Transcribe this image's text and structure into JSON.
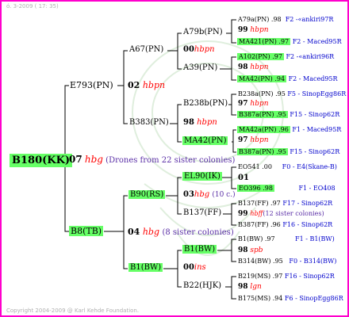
{
  "header": "ó. 3-2009 ( 17: 35)",
  "footer": "Copyright 2004-2009 @ Karl Kehde Foundation.",
  "root": {
    "name": "B180(KK)",
    "year": "07",
    "species": "hbg",
    "note": "(Drones from 22 sister colonies)"
  },
  "gen1": [
    {
      "name": "E793(PN)",
      "year": "02",
      "species": "hbpn"
    },
    {
      "name": "B8(TB)",
      "year": "04",
      "species": "hbg",
      "note": "(8 sister colonies)"
    }
  ],
  "gen2": [
    {
      "name": "A67(PN)",
      "year": "00",
      "species": "hbpn"
    },
    {
      "name": "B383(PN)",
      "year": "98",
      "species": "hbpn"
    },
    {
      "name": "B90(RS)",
      "year": "03",
      "species": "hbg",
      "note": "(10 c.)"
    },
    {
      "name": "B1(BW)",
      "year": "00",
      "species": "ins"
    }
  ],
  "gen3": [
    {
      "name": "A79b(PN)"
    },
    {
      "name": "A39(PN)"
    },
    {
      "name": "B238b(PN)"
    },
    {
      "name": "MA42(PN)"
    },
    {
      "name": "EL90(IK)",
      "year": "01"
    },
    {
      "name": "B137(FF)"
    },
    {
      "name": "B1(BW)"
    },
    {
      "name": "B22(HJK)"
    }
  ],
  "gen4": [
    {
      "name": "A79a(PN)",
      "year": ".98",
      "ref": "F2 -«ankiri97R",
      "num": "99",
      "species": "hbpn"
    },
    {
      "name": "MA421(PN)",
      "year": ".97",
      "ref": "F2 - Maced95R"
    },
    {
      "name": "A102(PN)",
      "year": ".97",
      "ref": "F2 -«ankiri96R",
      "num": "98",
      "species": "hbpn"
    },
    {
      "name": "MA42(PN)",
      "year": ".94",
      "ref": "F2 - Maced95R"
    },
    {
      "name": "B238a(PN)",
      "year": ".95",
      "ref": "F5 - SinopEgg86R",
      "num": "97",
      "species": "hbpn"
    },
    {
      "name": "B387a(PN)",
      "year": ".95",
      "ref": "F15 - Sinop62R"
    },
    {
      "name": "MA42a(PN)",
      "year": ".96",
      "ref": "F1 - Maced95R",
      "num": "97",
      "species": "hbpn"
    },
    {
      "name": "B387a(PN)",
      "year": ".95",
      "ref": "F15 - Sinop62R"
    },
    {
      "name": "EO541",
      "year": ".00",
      "ref": "F0 - E4(Skane-B)"
    },
    {
      "name": "EO396",
      "year": ".98",
      "ref": "F1 - EO408"
    },
    {
      "name": "B137(FF)",
      "year": ".97",
      "ref": "F17 - Sinop62R",
      "num": "99",
      "species": "hbff",
      "note": "(12 sister colonies)"
    },
    {
      "name": "B387(FF)",
      "year": ".96",
      "ref": "F16 - Sinop62R"
    },
    {
      "name": "B1(BW)",
      "year": ".97",
      "ref": "F1 - B1(BW)",
      "num": "98",
      "species": "spb"
    },
    {
      "name": "B314(BW)",
      "year": ".95",
      "ref": "F0 - B314(BW)"
    },
    {
      "name": "B219(MS)",
      "year": ".97",
      "ref": "F16 - Sinop62R",
      "num": "98",
      "species": "lgn"
    },
    {
      "name": "B175(MS)",
      "year": ".94",
      "ref": "F6 - SinopEgg86R"
    }
  ]
}
